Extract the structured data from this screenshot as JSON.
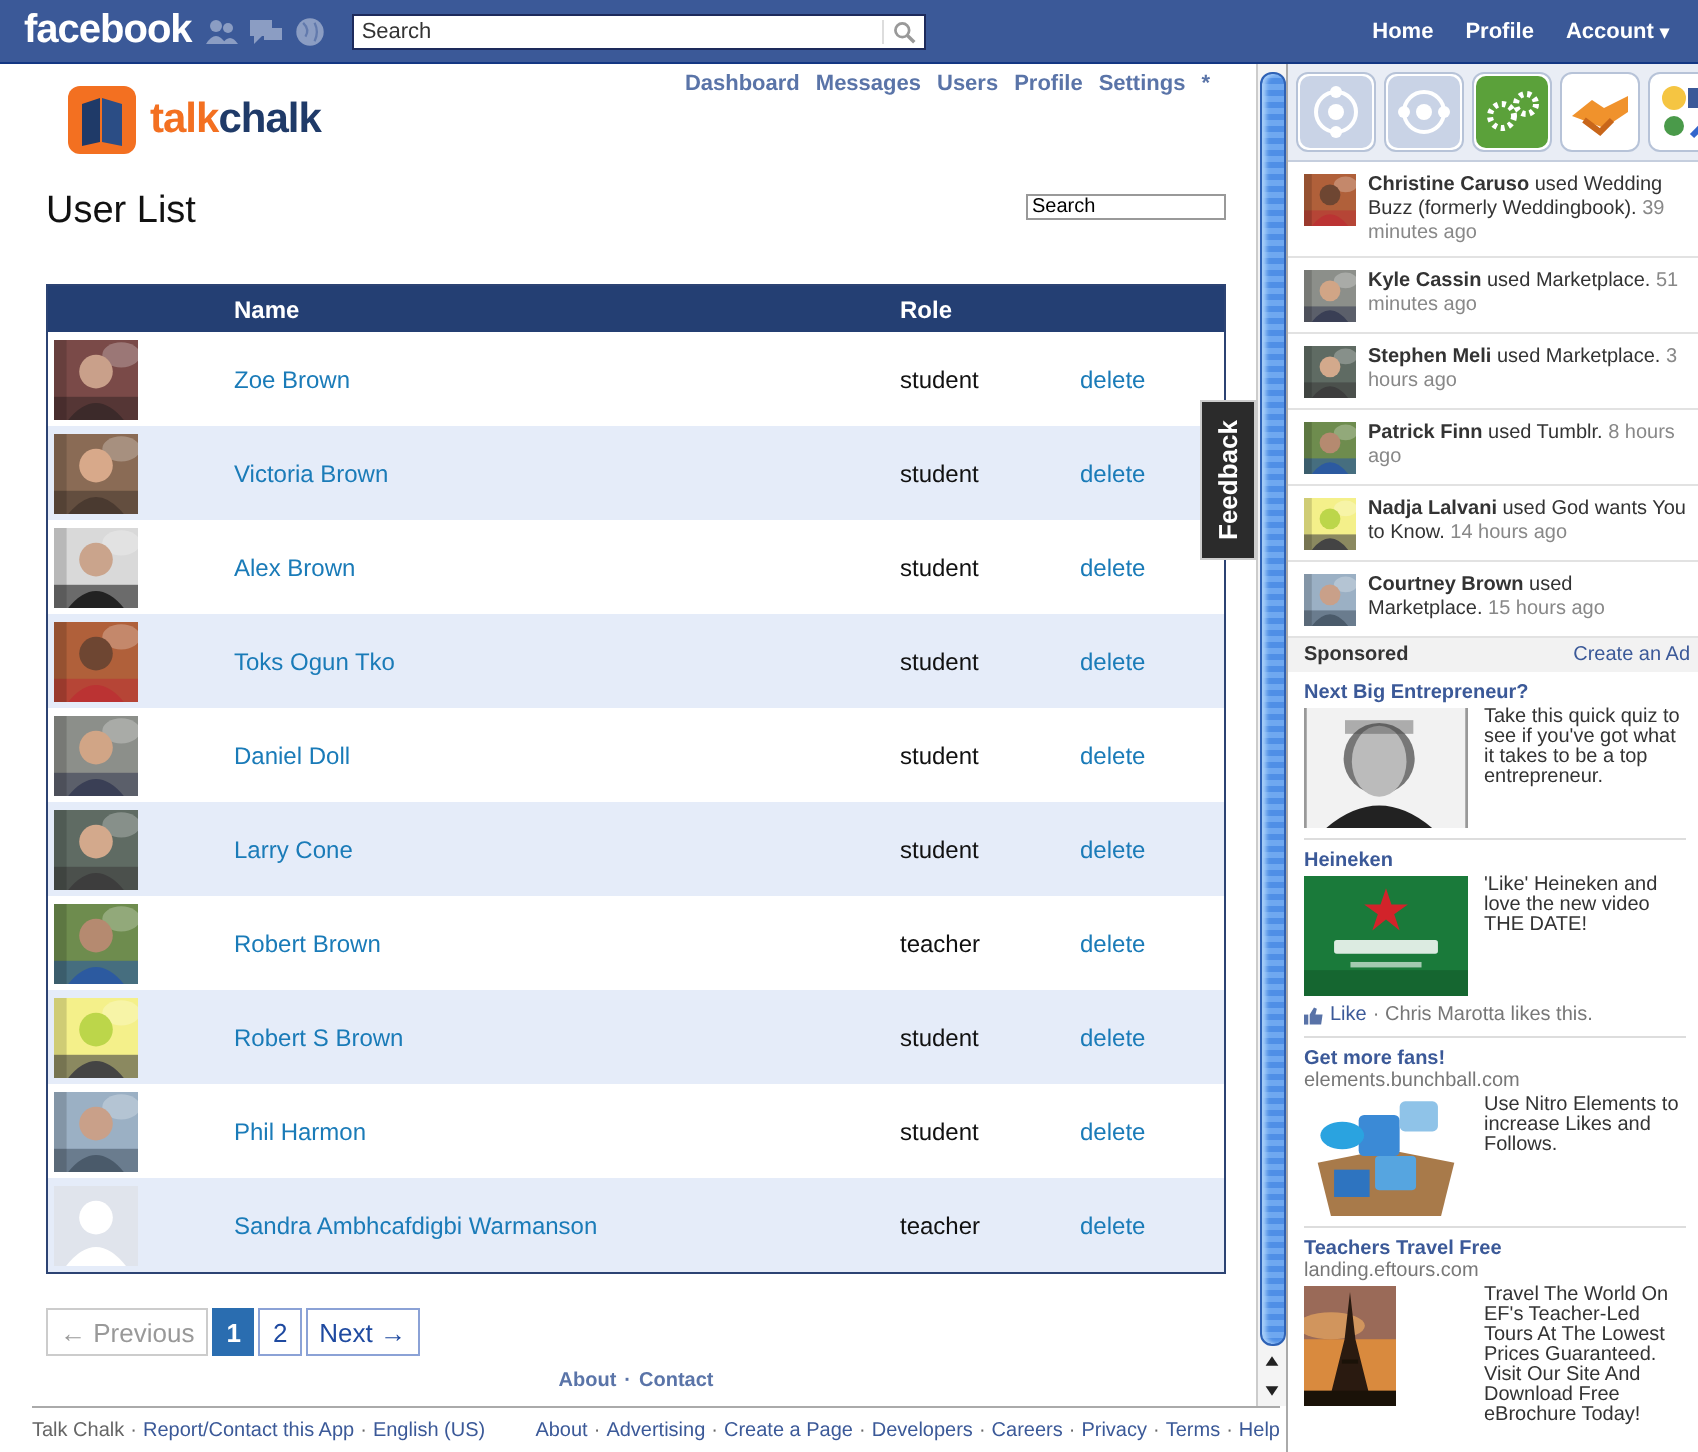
{
  "topbar": {
    "logo": "facebook",
    "search": {
      "placeholder": "Search"
    },
    "nav": [
      {
        "label": "Home"
      },
      {
        "label": "Profile"
      },
      {
        "label": "Account",
        "caret": "▾"
      }
    ]
  },
  "app": {
    "nav": [
      "Dashboard",
      "Messages",
      "Users",
      "Profile",
      "Settings",
      "*"
    ],
    "logo": {
      "first": "talk",
      "second": "chalk"
    },
    "title": "User List",
    "search": {
      "placeholder": "Search"
    },
    "table": {
      "columns": [
        "Name",
        "Role"
      ],
      "rows": [
        {
          "name": "Zoe Brown",
          "role": "student",
          "action": "delete"
        },
        {
          "name": "Victoria Brown",
          "role": "student",
          "action": "delete"
        },
        {
          "name": "Alex Brown",
          "role": "student",
          "action": "delete"
        },
        {
          "name": "Toks Ogun Tko",
          "role": "student",
          "action": "delete"
        },
        {
          "name": "Daniel Doll",
          "role": "student",
          "action": "delete"
        },
        {
          "name": "Larry Cone",
          "role": "student",
          "action": "delete"
        },
        {
          "name": "Robert Brown",
          "role": "teacher",
          "action": "delete"
        },
        {
          "name": "Robert S Brown",
          "role": "student",
          "action": "delete"
        },
        {
          "name": "Phil Harmon",
          "role": "student",
          "action": "delete"
        },
        {
          "kind": "silhouette",
          "name": "Sandra Ambhcafdigbi Warmanson",
          "role": "teacher",
          "action": "delete"
        }
      ]
    },
    "pagination": [
      {
        "label": "← Previous",
        "disabled": true,
        "selected": false
      },
      {
        "label": "1",
        "disabled": false,
        "selected": true
      },
      {
        "label": "2",
        "disabled": false,
        "selected": false
      },
      {
        "label": "Next →",
        "disabled": false,
        "selected": false
      }
    ],
    "bottom_links": {
      "items": [
        "About",
        "Contact"
      ],
      "separator": "·"
    },
    "feedback": "Feedback"
  },
  "sidebar": {
    "activity": [
      {
        "text": "**Christine Caruso** used Wedding Buzz (formerly Weddingbook).",
        "time": "39 minutes ago"
      },
      {
        "text": "**Kyle Cassin** used Marketplace.",
        "time": "51 minutes ago"
      },
      {
        "text": "**Stephen Meli** used Marketplace.",
        "time": "3 hours ago"
      },
      {
        "text": "**Patrick Finn** used Tumblr.",
        "time": "8 hours ago"
      },
      {
        "text": "**Nadja Lalvani** used God wants You to Know.",
        "time": "14 hours ago"
      },
      {
        "text": "**Courtney Brown** used Marketplace.",
        "time": "15 hours ago"
      }
    ],
    "sponsored": {
      "title": "Sponsored",
      "link": "Create an Ad"
    },
    "ads": [
      {
        "kind": "person",
        "title": "Next Big Entrepreneur?",
        "text": "Take this quick quiz to see if you've got what it takes to be a top entrepreneur."
      },
      {
        "kind": "beer",
        "title": "Heineken",
        "text": "'Like' Heineken and love the new video THE DATE!",
        "like": "Like",
        "likes": "· Chris Marotta likes this."
      },
      {
        "kind": "box",
        "title": "Get more fans!",
        "domain": "elements.bunchball.com",
        "text": "Use Nitro Elements to increase Likes and Follows."
      },
      {
        "kind": "tower",
        "title": "Teachers Travel Free",
        "domain": "landing.eftours.com",
        "text": "Travel The World On EF's Teacher-Led Tours At The Lowest Prices Guaranteed. Visit Our Site And Download Free eBrochure Today!"
      }
    ]
  },
  "footer": {
    "separator": "·",
    "left": [
      "Talk Chalk",
      "Report/Contact this App",
      "English (US)"
    ],
    "right": [
      "About",
      "Advertising",
      "Create a Page",
      "Developers",
      "Careers",
      "Privacy",
      "Terms",
      "Help"
    ]
  }
}
